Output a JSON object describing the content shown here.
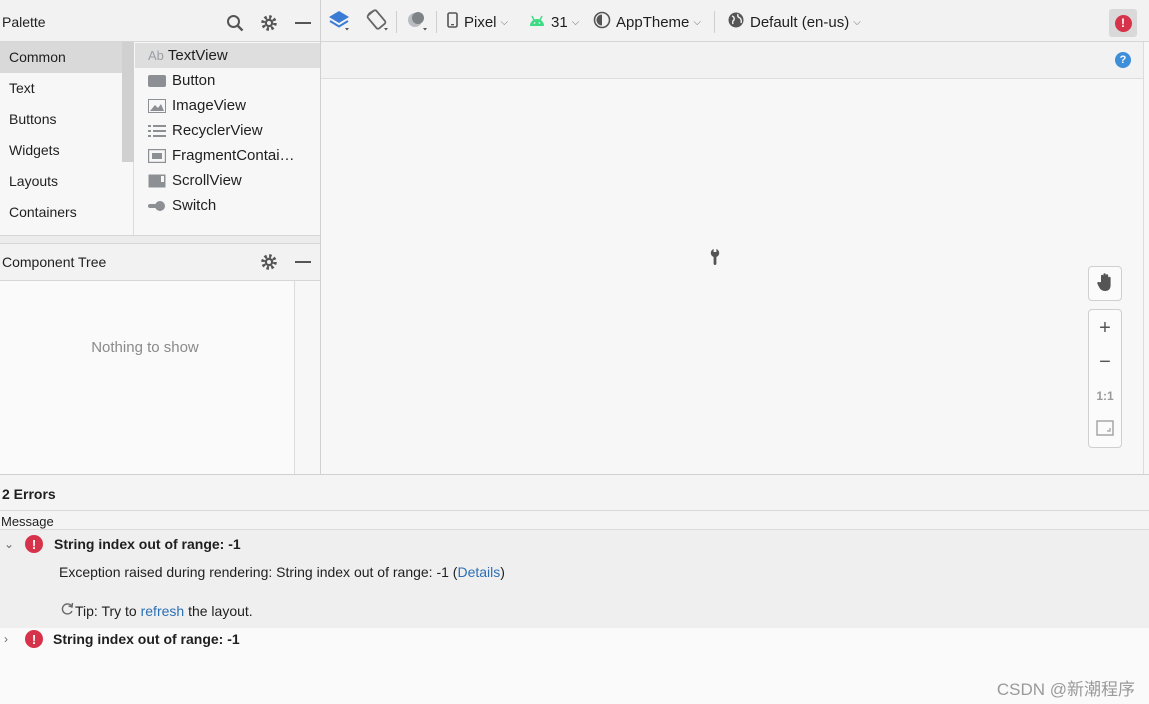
{
  "palette": {
    "title": "Palette",
    "categories": [
      "Common",
      "Text",
      "Buttons",
      "Widgets",
      "Layouts",
      "Containers"
    ],
    "selected_category": "Common",
    "widgets": [
      "TextView",
      "Button",
      "ImageView",
      "RecyclerView",
      "FragmentContai…",
      "ScrollView",
      "Switch"
    ],
    "selected_widget": "TextView",
    "textview_badge": "Ab"
  },
  "component_tree": {
    "title": "Component Tree",
    "empty_text": "Nothing to show"
  },
  "toolbar": {
    "device": "Pixel",
    "api_level": "31",
    "theme": "AppTheme",
    "locale": "Default (en-us)"
  },
  "zoom": {
    "plus": "+",
    "minus": "−",
    "one_to_one": "1:1"
  },
  "errors": {
    "count_label": "2 Errors",
    "message_header": "Message",
    "items": [
      {
        "title": "String index out of range: -1",
        "detail_prefix": "Exception raised during rendering: String index out of range: -1 (",
        "detail_link": "Details",
        "detail_suffix": ")",
        "tip_prefix": "Tip: Try to ",
        "tip_link": "refresh",
        "tip_suffix": " the layout."
      },
      {
        "title": "String index out of range: -1"
      }
    ]
  },
  "watermark": "CSDN @新潮程序",
  "colors": {
    "error_red": "#d6334a",
    "link_blue": "#2c6fb4",
    "android_green": "#3ddc84",
    "help_blue": "#3d8fd9"
  }
}
